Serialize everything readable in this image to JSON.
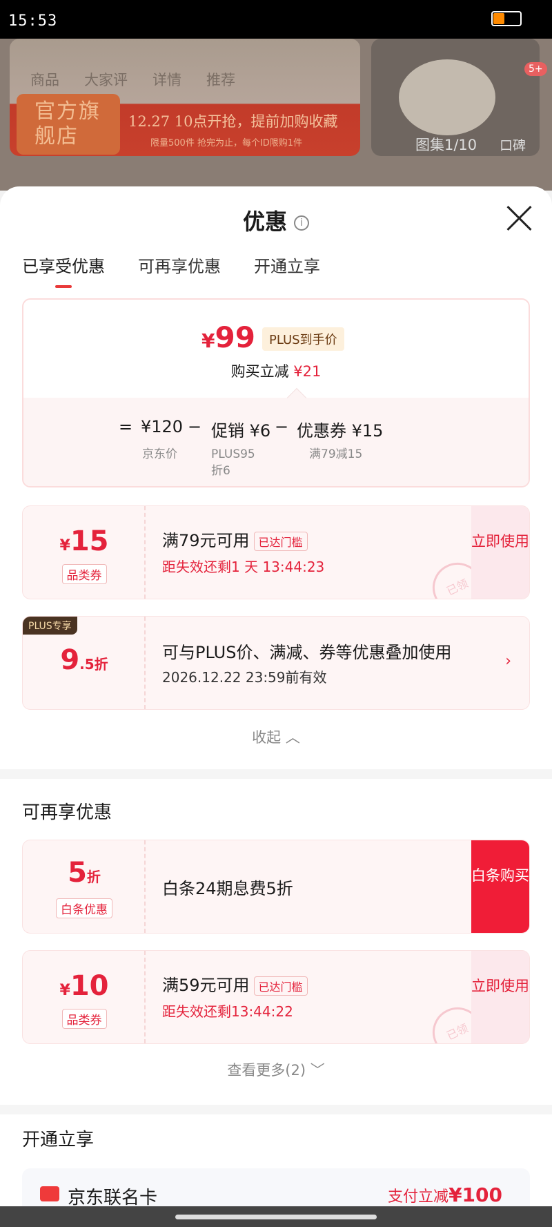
{
  "status_bar": {
    "time": "15:53"
  },
  "background": {
    "nav_tabs": [
      "商品",
      "大家评",
      "详情",
      "推荐"
    ],
    "store_badge": "官方旗舰店",
    "promo_line": "12.27 10点开抢，提前加购收藏",
    "limit_line": "限量500件 抢完为止，每个ID限购1件",
    "gallery_counter": "图集1/10",
    "gallery_tag": "口碑",
    "cart_badge": "5+"
  },
  "sheet": {
    "title": "优惠",
    "info_icon": "i",
    "tabs": [
      {
        "label": "已享受优惠",
        "active": true
      },
      {
        "label": "可再享优惠",
        "active": false
      },
      {
        "label": "开通立享",
        "active": false
      }
    ]
  },
  "summary": {
    "currency": "¥",
    "final_price": "99",
    "price_tag": "PLUS到手价",
    "reduce_label": "购买立减",
    "reduce_value": "¥21",
    "equals": "=",
    "minus": "−",
    "base_price": "¥120",
    "base_label": "京东价",
    "promo_price": "促销 ¥6",
    "promo_label": "PLUS95折6",
    "coupon_price": "优惠券 ¥15",
    "coupon_label": "满79减15"
  },
  "enjoyed": [
    {
      "currency": "¥",
      "value": "15",
      "kind": "品类券",
      "condition": "满79元可用",
      "reached": "已达门槛",
      "expiry": "距失效还剩1 天 13:44:23",
      "action": "立即使用",
      "stamp": "已领"
    },
    {
      "corner_tag": "PLUS专享",
      "value": "9",
      "unit": ".5折",
      "title": "可与PLUS价、满减、券等优惠叠加使用",
      "valid": "2026.12.22 23:59前有效",
      "arrow": "›"
    }
  ],
  "collapse_label": "收起 ︿",
  "more_section": {
    "title": "可再享优惠",
    "items": [
      {
        "value": "5",
        "unit": "折",
        "kind": "白条优惠",
        "title": "白条24期息费5折",
        "action": "白条购买"
      },
      {
        "currency": "¥",
        "value": "10",
        "kind": "品类券",
        "condition": "满59元可用",
        "reached": "已达门槛",
        "expiry": "距失效还剩13:44:22",
        "action": "立即使用",
        "stamp": "已领"
      }
    ],
    "see_more": "查看更多(2) ﹀"
  },
  "open_section": {
    "title": "开通立享",
    "card_name": "京东联名卡",
    "card_promo_label": "支付立减",
    "card_promo_value": "¥100"
  },
  "colors": {
    "accent": "#e4223b",
    "action_fill": "#f01d37",
    "plus_tag_bg": "#4a3322"
  }
}
